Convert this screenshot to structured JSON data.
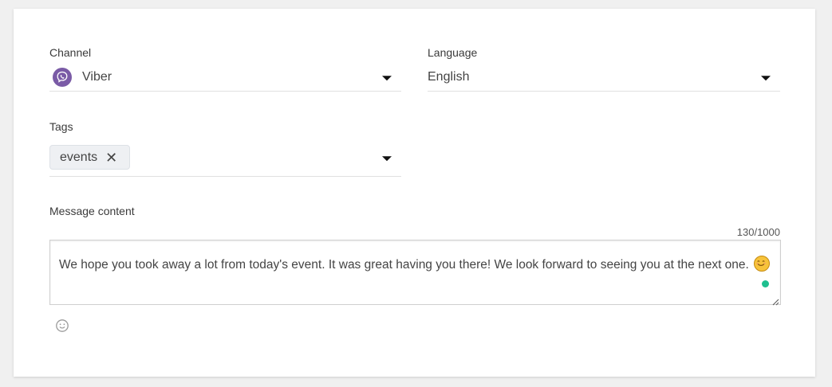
{
  "form": {
    "channel": {
      "label": "Channel",
      "value": "Viber",
      "icon": "viber-icon",
      "icon_color": "#7a5ba6"
    },
    "language": {
      "label": "Language",
      "value": "English"
    },
    "tags": {
      "label": "Tags",
      "chips": [
        {
          "label": "events",
          "remove": "✕"
        }
      ]
    },
    "message": {
      "label": "Message content",
      "counter": "130/1000",
      "text": "We hope you took away a lot from today's event. It was great having you there! We look forward to seeing you at the next one.",
      "trailing_emoji": "smiling-face-emoji",
      "status_color": "#1fbf8f"
    },
    "emoji_picker": {
      "icon": "smiley-icon"
    }
  }
}
